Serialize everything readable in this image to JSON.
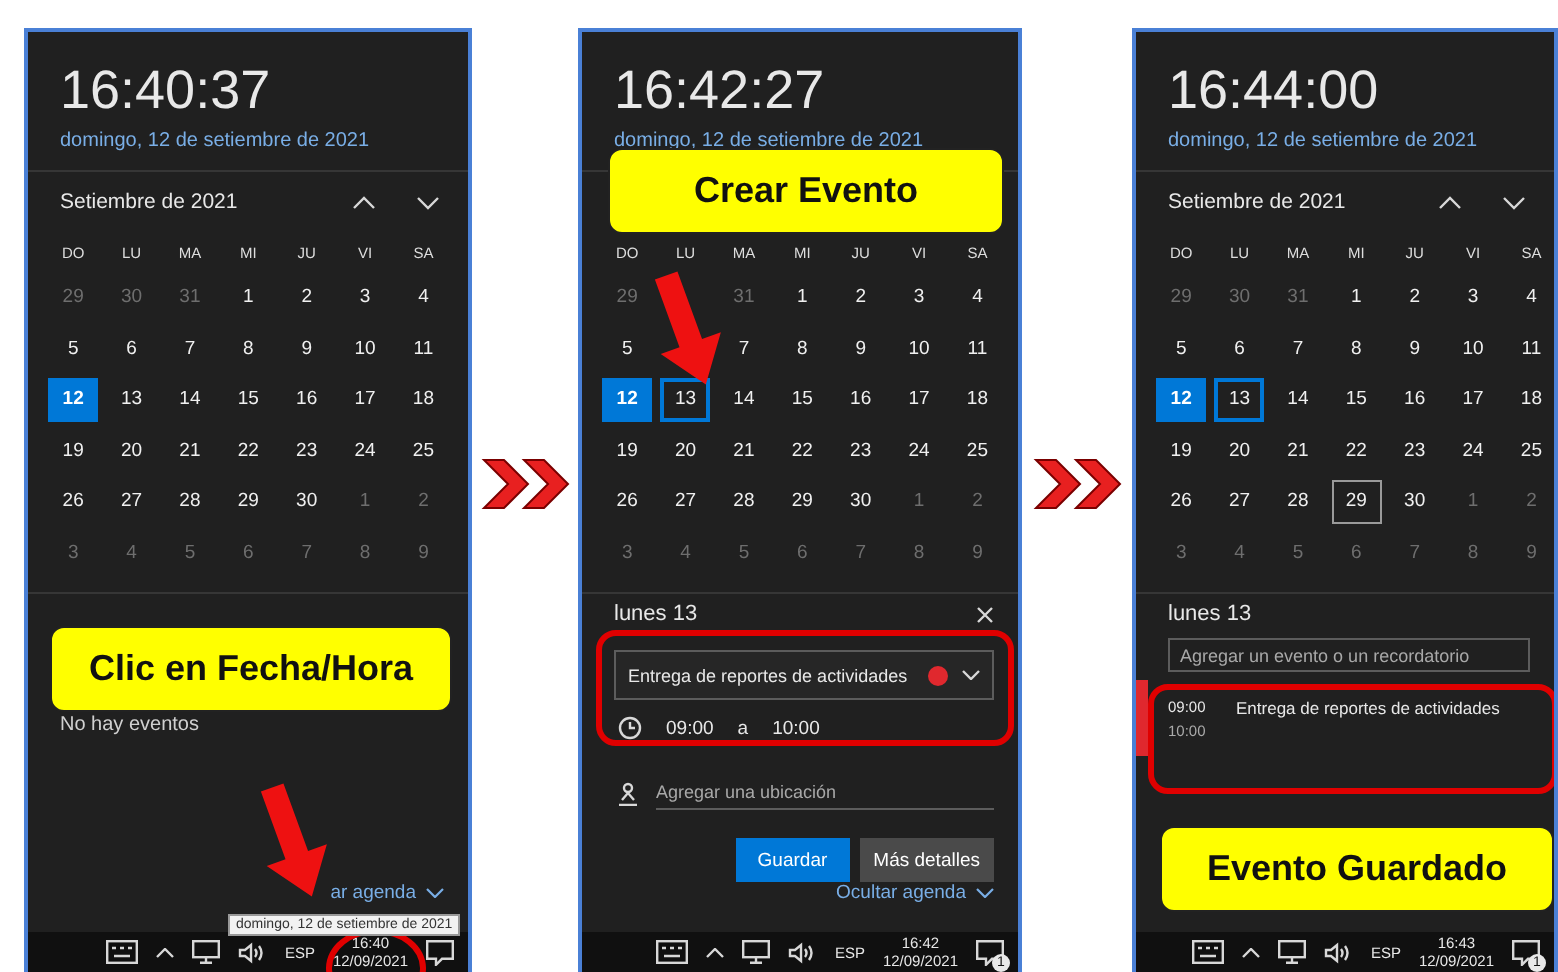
{
  "panels": [
    {
      "clock": "16:40:37",
      "date": "domingo, 12 de setiembre de 2021",
      "month": "Setiembre de 2021",
      "weekdays": [
        "DO",
        "LU",
        "MA",
        "MI",
        "JU",
        "VI",
        "SA"
      ],
      "weeks": [
        [
          {
            "day": "29",
            "other_month": true,
            "selected": false
          },
          {
            "day": "30",
            "other_month": true,
            "selected": false
          },
          {
            "day": "31",
            "other_month": true,
            "selected": false
          },
          {
            "day": "1",
            "other_month": false,
            "selected": false
          },
          {
            "day": "2",
            "other_month": false,
            "selected": false
          },
          {
            "day": "3",
            "other_month": false,
            "selected": false
          },
          {
            "day": "4",
            "other_month": false,
            "selected": false
          }
        ],
        [
          {
            "day": "5",
            "other_month": false,
            "selected": false
          },
          {
            "day": "6",
            "other_month": false,
            "selected": false
          },
          {
            "day": "7",
            "other_month": false,
            "selected": false
          },
          {
            "day": "8",
            "other_month": false,
            "selected": false
          },
          {
            "day": "9",
            "other_month": false,
            "selected": false
          },
          {
            "day": "10",
            "other_month": false,
            "selected": false
          },
          {
            "day": "11",
            "other_month": false,
            "selected": false
          }
        ],
        [
          {
            "day": "12",
            "other_month": false,
            "selected": true
          },
          {
            "day": "13",
            "other_month": false,
            "selected": false
          },
          {
            "day": "14",
            "other_month": false,
            "selected": false
          },
          {
            "day": "15",
            "other_month": false,
            "selected": false
          },
          {
            "day": "16",
            "other_month": false,
            "selected": false
          },
          {
            "day": "17",
            "other_month": false,
            "selected": false
          },
          {
            "day": "18",
            "other_month": false,
            "selected": false
          }
        ],
        [
          {
            "day": "19",
            "other_month": false,
            "selected": false
          },
          {
            "day": "20",
            "other_month": false,
            "selected": false
          },
          {
            "day": "21",
            "other_month": false,
            "selected": false
          },
          {
            "day": "22",
            "other_month": false,
            "selected": false
          },
          {
            "day": "23",
            "other_month": false,
            "selected": false
          },
          {
            "day": "24",
            "other_month": false,
            "selected": false
          },
          {
            "day": "25",
            "other_month": false,
            "selected": false
          }
        ],
        [
          {
            "day": "26",
            "other_month": false,
            "selected": false
          },
          {
            "day": "27",
            "other_month": false,
            "selected": false
          },
          {
            "day": "28",
            "other_month": false,
            "selected": false
          },
          {
            "day": "29",
            "other_month": false,
            "selected": false
          },
          {
            "day": "30",
            "other_month": false,
            "selected": false
          },
          {
            "day": "1",
            "other_month": true,
            "selected": false
          },
          {
            "day": "2",
            "other_month": true,
            "selected": false
          }
        ],
        [
          {
            "day": "3",
            "other_month": true,
            "selected": false
          },
          {
            "day": "4",
            "other_month": true,
            "selected": false
          },
          {
            "day": "5",
            "other_month": true,
            "selected": false
          },
          {
            "day": "6",
            "other_month": true,
            "selected": false
          },
          {
            "day": "7",
            "other_month": true,
            "selected": false
          },
          {
            "day": "8",
            "other_month": true,
            "selected": false
          },
          {
            "day": "9",
            "other_month": true,
            "selected": false
          }
        ]
      ],
      "agenda": [
        {
          "kind": "empty-note",
          "text": "No hay eventos"
        },
        {
          "kind": "toggle",
          "text": "ar agenda"
        }
      ],
      "taskbar": {
        "language": "ESP",
        "time": "16:40",
        "date": "12/09/2021"
      },
      "annotations": [
        {
          "kind": "callout",
          "text": "Clic en Fecha/Hora"
        },
        {
          "kind": "arrow"
        },
        {
          "kind": "ring"
        },
        {
          "kind": "tooltip",
          "text": "domingo, 12 de setiembre de 2021"
        }
      ]
    },
    {
      "clock": "16:42:27",
      "date": "domingo, 12 de setiembre de 2021",
      "weekdays": [
        "DO",
        "LU",
        "MA",
        "MI",
        "JU",
        "VI",
        "SA"
      ],
      "weeks": [
        [
          {
            "day": "29",
            "other_month": true,
            "selected": false
          },
          {
            "kind": "covered"
          },
          {
            "day": "31",
            "other_month": true,
            "selected": false
          },
          {
            "day": "1",
            "other_month": false,
            "selected": false
          },
          {
            "day": "2",
            "other_month": false,
            "selected": false
          },
          {
            "day": "3",
            "other_month": false,
            "selected": false
          },
          {
            "day": "4",
            "other_month": false,
            "selected": false
          }
        ],
        [
          {
            "day": "5",
            "other_month": false,
            "selected": false
          },
          {
            "kind": "covered"
          },
          {
            "day": "7",
            "other_month": false,
            "selected": false
          },
          {
            "day": "8",
            "other_month": false,
            "selected": false
          },
          {
            "day": "9",
            "other_month": false,
            "selected": false
          },
          {
            "day": "10",
            "other_month": false,
            "selected": false
          },
          {
            "day": "11",
            "other_month": false,
            "selected": false
          }
        ],
        [
          {
            "day": "12",
            "other_month": false,
            "selected": true,
            "focused": false
          },
          {
            "day": "13",
            "other_month": false,
            "selected": false,
            "focused": true
          },
          {
            "day": "14",
            "other_month": false,
            "selected": false,
            "focused": false
          },
          {
            "day": "15",
            "other_month": false,
            "selected": false,
            "focused": false
          },
          {
            "day": "16",
            "other_month": false,
            "selected": false,
            "focused": false
          },
          {
            "day": "17",
            "other_month": false,
            "selected": false,
            "focused": false
          },
          {
            "day": "18",
            "other_month": false,
            "selected": false,
            "focused": false
          }
        ],
        [
          {
            "day": "19",
            "other_month": false,
            "selected": false
          },
          {
            "day": "20",
            "other_month": false,
            "selected": false
          },
          {
            "day": "21",
            "other_month": false,
            "selected": false
          },
          {
            "day": "22",
            "other_month": false,
            "selected": false
          },
          {
            "day": "23",
            "other_month": false,
            "selected": false
          },
          {
            "day": "24",
            "other_month": false,
            "selected": false
          },
          {
            "day": "25",
            "other_month": false,
            "selected": false
          }
        ],
        [
          {
            "day": "26",
            "other_month": false,
            "selected": false
          },
          {
            "day": "27",
            "other_month": false,
            "selected": false
          },
          {
            "day": "28",
            "other_month": false,
            "selected": false
          },
          {
            "day": "29",
            "other_month": false,
            "selected": false
          },
          {
            "day": "30",
            "other_month": false,
            "selected": false
          },
          {
            "day": "1",
            "other_month": true,
            "selected": false
          },
          {
            "day": "2",
            "other_month": true,
            "selected": false
          }
        ],
        [
          {
            "day": "3",
            "other_month": true,
            "selected": false
          },
          {
            "day": "4",
            "other_month": true,
            "selected": false
          },
          {
            "day": "5",
            "other_month": true,
            "selected": false
          },
          {
            "day": "6",
            "other_month": true,
            "selected": false
          },
          {
            "day": "7",
            "other_month": true,
            "selected": false
          },
          {
            "day": "8",
            "other_month": true,
            "selected": false
          },
          {
            "day": "9",
            "other_month": true,
            "selected": false
          }
        ]
      ],
      "agenda": [
        {
          "kind": "heading",
          "text": "lunes 13",
          "closable": true
        },
        {
          "kind": "event-form",
          "title": "Entrega de reportes de actividades",
          "color": "#e0282e"
        },
        {
          "kind": "time-row",
          "start": "09:00",
          "connector": "a",
          "end": "10:00"
        },
        {
          "kind": "location-field",
          "placeholder": "Agregar una ubicación"
        },
        {
          "kind": "buttons",
          "buttons": [
            {
              "label": "Guardar",
              "primary": true
            },
            {
              "label": "Más detalles",
              "primary": false
            }
          ]
        },
        {
          "kind": "toggle",
          "text": "Ocultar agenda"
        }
      ],
      "taskbar": {
        "language": "ESP",
        "time": "16:42",
        "date": "12/09/2021",
        "badge": "1"
      },
      "annotations": [
        {
          "kind": "callout",
          "text": "Crear Evento"
        },
        {
          "kind": "arrow"
        },
        {
          "kind": "ring"
        }
      ]
    },
    {
      "clock": "16:44:00",
      "date": "domingo, 12 de setiembre de 2021",
      "month": "Setiembre de 2021",
      "weekdays": [
        "DO",
        "LU",
        "MA",
        "MI",
        "JU",
        "VI",
        "SA"
      ],
      "weeks": [
        [
          {
            "day": "29",
            "other_month": true,
            "selected": false
          },
          {
            "day": "30",
            "other_month": true,
            "selected": false
          },
          {
            "day": "31",
            "other_month": true,
            "selected": false
          },
          {
            "day": "1",
            "other_month": false,
            "selected": false
          },
          {
            "day": "2",
            "other_month": false,
            "selected": false
          },
          {
            "day": "3",
            "other_month": false,
            "selected": false
          },
          {
            "day": "4",
            "other_month": false,
            "selected": false
          }
        ],
        [
          {
            "day": "5",
            "other_month": false,
            "selected": false
          },
          {
            "day": "6",
            "other_month": false,
            "selected": false
          },
          {
            "day": "7",
            "other_month": false,
            "selected": false
          },
          {
            "day": "8",
            "other_month": false,
            "selected": false
          },
          {
            "day": "9",
            "other_month": false,
            "selected": false
          },
          {
            "day": "10",
            "other_month": false,
            "selected": false
          },
          {
            "day": "11",
            "other_month": false,
            "selected": false
          }
        ],
        [
          {
            "day": "12",
            "other_month": false,
            "selected": true,
            "focused": false
          },
          {
            "day": "13",
            "other_month": false,
            "selected": false,
            "focused": true
          },
          {
            "day": "14",
            "other_month": false,
            "selected": false,
            "focused": false
          },
          {
            "day": "15",
            "other_month": false,
            "selected": false,
            "focused": false
          },
          {
            "day": "16",
            "other_month": false,
            "selected": false,
            "focused": false
          },
          {
            "day": "17",
            "other_month": false,
            "selected": false,
            "focused": false
          },
          {
            "day": "18",
            "other_month": false,
            "selected": false,
            "focused": false
          }
        ],
        [
          {
            "day": "19",
            "other_month": false,
            "selected": false
          },
          {
            "day": "20",
            "other_month": false,
            "selected": false
          },
          {
            "day": "21",
            "other_month": false,
            "selected": false
          },
          {
            "day": "22",
            "other_month": false,
            "selected": false
          },
          {
            "day": "23",
            "other_month": false,
            "selected": false
          },
          {
            "day": "24",
            "other_month": false,
            "selected": false
          },
          {
            "day": "25",
            "other_month": false,
            "selected": false
          }
        ],
        [
          {
            "day": "26",
            "other_month": false,
            "selected": false,
            "hovered": false
          },
          {
            "day": "27",
            "other_month": false,
            "selected": false,
            "hovered": false
          },
          {
            "day": "28",
            "other_month": false,
            "selected": false,
            "hovered": false
          },
          {
            "day": "29",
            "other_month": false,
            "selected": false,
            "hovered": true
          },
          {
            "day": "30",
            "other_month": false,
            "selected": false,
            "hovered": false
          },
          {
            "day": "1",
            "other_month": true,
            "selected": false,
            "hovered": false
          },
          {
            "day": "2",
            "other_month": true,
            "selected": false,
            "hovered": false
          }
        ],
        [
          {
            "day": "3",
            "other_month": true,
            "selected": false
          },
          {
            "day": "4",
            "other_month": true,
            "selected": false
          },
          {
            "day": "5",
            "other_month": true,
            "selected": false
          },
          {
            "day": "6",
            "other_month": true,
            "selected": false
          },
          {
            "day": "7",
            "other_month": true,
            "selected": false
          },
          {
            "day": "8",
            "other_month": true,
            "selected": false
          },
          {
            "day": "9",
            "other_month": true,
            "selected": false
          }
        ]
      ],
      "agenda": [
        {
          "kind": "heading",
          "text": "lunes 13",
          "closable": false
        },
        {
          "kind": "add-field",
          "placeholder": "Agregar un evento o un recordatorio"
        },
        {
          "kind": "event",
          "start": "09:00",
          "end": "10:00",
          "title": "Entrega de reportes de actividades",
          "color": "#e0282e"
        }
      ],
      "taskbar": {
        "language": "ESP",
        "time": "16:43",
        "date": "12/09/2021",
        "badge": "1"
      },
      "annotations": [
        {
          "kind": "ring"
        },
        {
          "kind": "callout",
          "text": "Evento Guardado"
        }
      ]
    }
  ]
}
